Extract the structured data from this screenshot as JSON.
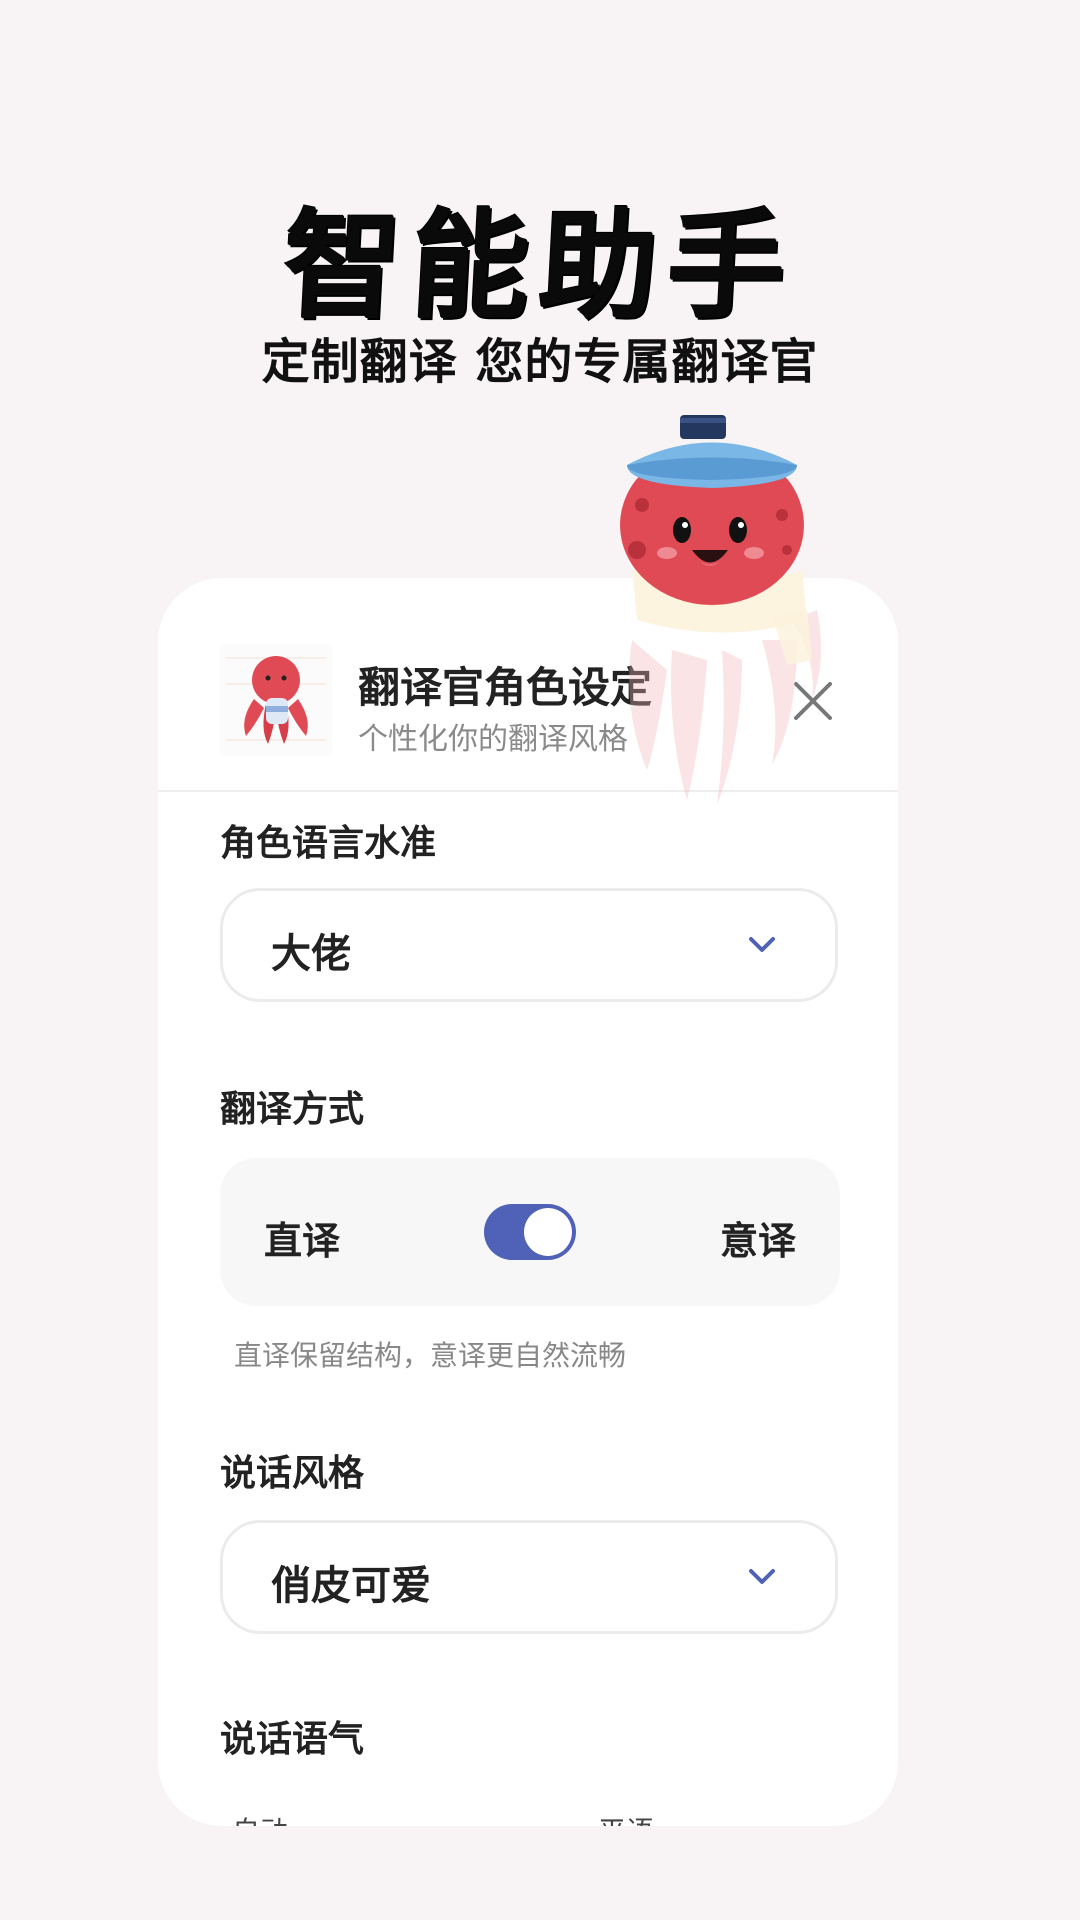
{
  "hero": {
    "title": "智能助手",
    "subtitle": "定制翻译 您的专属翻译官"
  },
  "card": {
    "title": "翻译官角色设定",
    "subtitle": "个性化你的翻译风格",
    "close_icon": "close-icon",
    "sections": {
      "language_level": {
        "label": "角色语言水准",
        "value": "大佬"
      },
      "translation_mode": {
        "label": "翻译方式",
        "left_option": "直译",
        "right_option": "意译",
        "selected": "意译",
        "hint": "直译保留结构，意译更自然流畅"
      },
      "speaking_style": {
        "label": "说话风格",
        "value": "俏皮可爱"
      },
      "speaking_tone": {
        "label": "说话语气",
        "options": [
          "自动",
          "平语"
        ]
      }
    }
  },
  "colors": {
    "background": "#f8f4f5",
    "accent": "#4f62b8",
    "card": "#ffffff"
  }
}
